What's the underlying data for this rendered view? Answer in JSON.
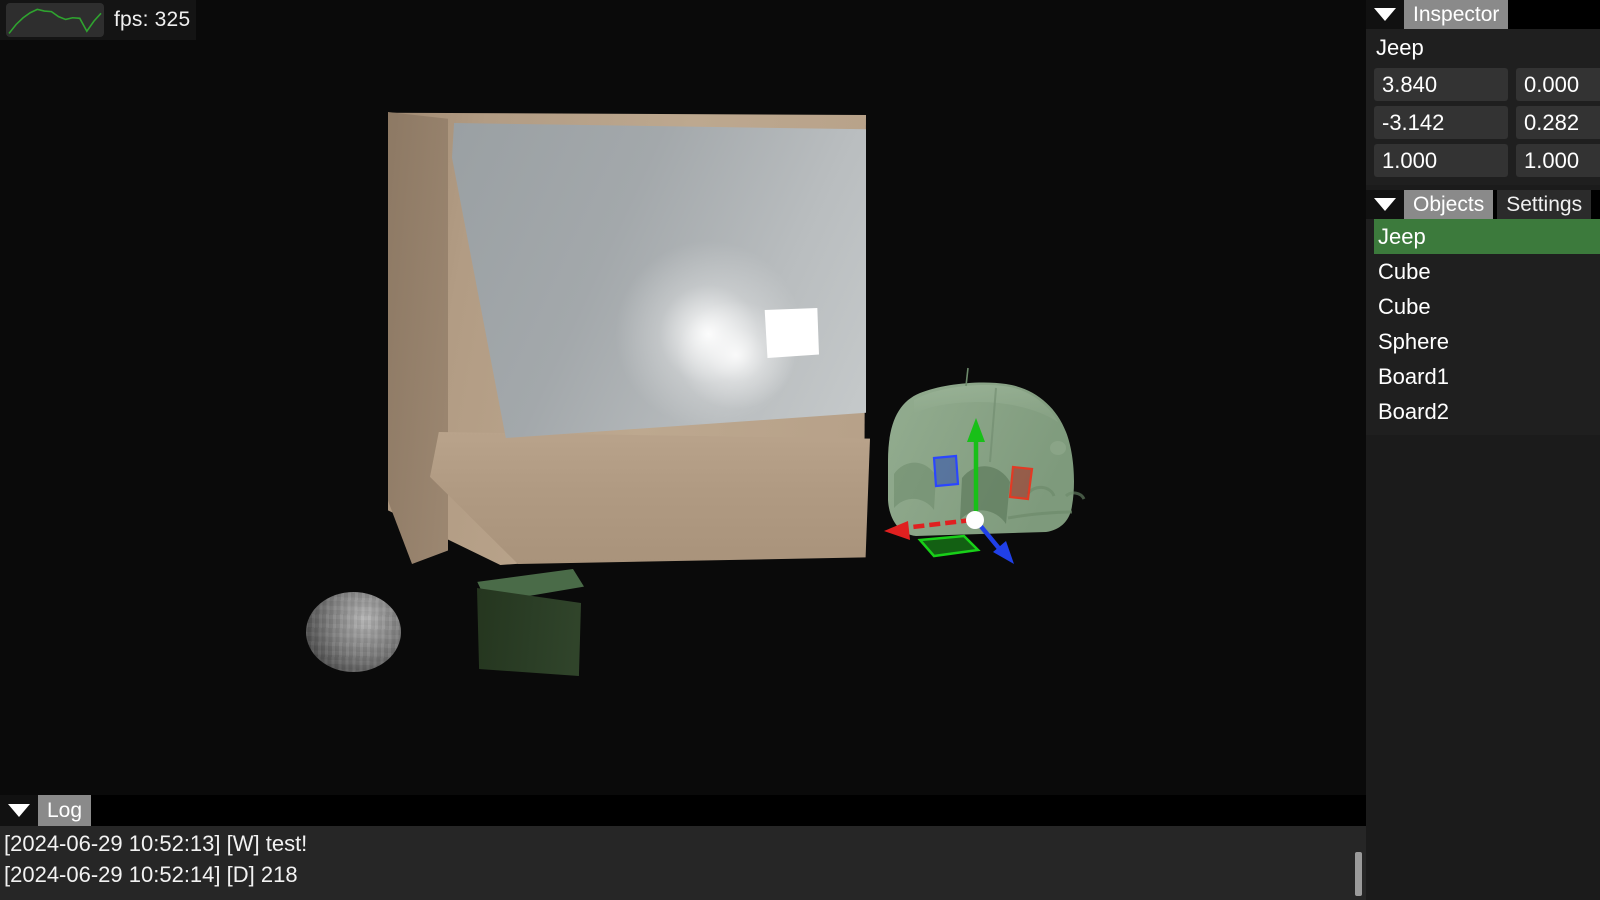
{
  "fps_overlay": {
    "icon": "fps-sparkline-graph",
    "label": "fps: 325",
    "graph_color": "#2fa32f",
    "graph_points": [
      2,
      34,
      58,
      76,
      88,
      82,
      80,
      62,
      52,
      58,
      56,
      10,
      46,
      74
    ]
  },
  "inspector": {
    "collapse_icon": "chevron-down-icon",
    "title": "Inspector",
    "object_name": "Jeep",
    "fields": [
      [
        "3.840",
        "0.000"
      ],
      [
        "-3.142",
        "0.282"
      ],
      [
        "1.000",
        "1.000"
      ]
    ]
  },
  "objects_panel": {
    "collapse_icon": "chevron-down-icon",
    "tab_active": "Objects",
    "tab_inactive": "Settings",
    "selected_index": 0,
    "items": [
      {
        "label": "Jeep"
      },
      {
        "label": "Cube"
      },
      {
        "label": "Cube"
      },
      {
        "label": "Sphere"
      },
      {
        "label": "Board1"
      },
      {
        "label": "Board2"
      }
    ],
    "selection_color": "#3c7a3c"
  },
  "log_panel": {
    "collapse_icon": "chevron-down-icon",
    "title": "Log",
    "lines": [
      "[2024-06-29 10:52:13] [W] test!",
      "[2024-06-29 10:52:14] [D] 218"
    ]
  },
  "viewport": {
    "scene_objects": [
      "Jeep",
      "Cube",
      "Cube",
      "Sphere",
      "Board1",
      "Board2"
    ],
    "gizmo": {
      "x_axis_color": "#e02020",
      "y_axis_color": "#18c018",
      "z_axis_color": "#2040e8",
      "origin_color": "#ffffff"
    },
    "jeep_color": "#8fa98c",
    "green_cube_color": "#2b3e26",
    "sphere_color": "#8a8a8a",
    "board_frame_color": "#b29c84",
    "board_screen_color": "#aab0b3"
  }
}
